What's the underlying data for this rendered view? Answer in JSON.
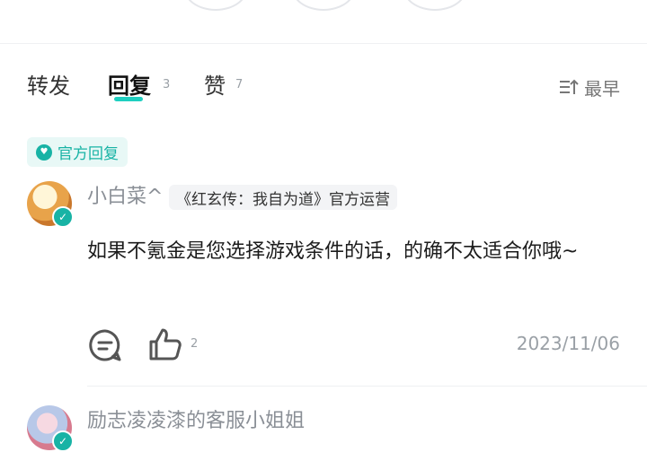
{
  "tabs": {
    "forward": "转发",
    "reply": "回复",
    "reply_count": "3",
    "like": "赞",
    "like_count": "7"
  },
  "sort": {
    "label": "最早",
    "icon": "sort-icon"
  },
  "official_badge": {
    "label": "官方回复",
    "icon": "heart-icon",
    "color": "#18b3a5"
  },
  "reply": {
    "username": "小白菜^",
    "title": "《红玄传：我自为道》官方运营",
    "content": "如果不氪金是您选择游戏条件的话，的确不太适合你哦~",
    "like_count": "2",
    "date": "2023/11/06"
  },
  "next_reply": {
    "username": "励志凌凌漆的客服小姐姐"
  },
  "colors": {
    "accent": "#1fcfc0",
    "muted": "#9aa0a6"
  }
}
